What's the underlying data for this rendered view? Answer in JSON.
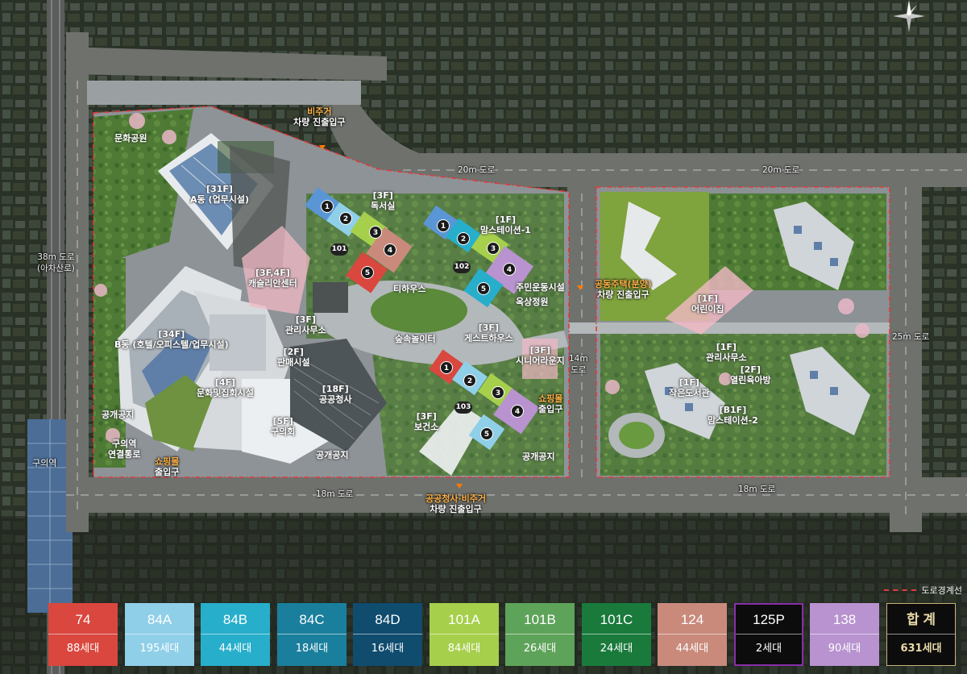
{
  "map": {
    "roads": {
      "top_left": "20m 도로",
      "top_right": "20m 도로",
      "left": "38m 도로\n(아차산로)",
      "right": "25m 도로",
      "middle": "14m\n도로",
      "bottom_left": "18m 도로",
      "bottom_right": "18m 도로"
    },
    "station": "구의역",
    "entrances": {
      "top": {
        "line1": "비주거",
        "line2": "차량 진출입구"
      },
      "right": {
        "line1": "공동주택(분양)",
        "line2": "차량 진출입구"
      },
      "bottom": {
        "line1": "공공청사·비주거",
        "line2": "차량 진출입구"
      },
      "shopping_left": {
        "line1": "쇼핑몰",
        "line2": "출입구"
      },
      "shopping_right": {
        "line1": "쇼핑몰",
        "line2": "출입구"
      }
    },
    "places": {
      "culture_park": "문화공원",
      "building_a": {
        "floor": "[31F]",
        "name": "A동 (업무시설)"
      },
      "building_b": {
        "floor": "[34F]",
        "name": "B동 (호텔/오피스텔/업무시설)"
      },
      "reading_room": {
        "floor": "[3F]",
        "name": "독서실"
      },
      "moms_station_1": {
        "floor": "[1F]",
        "name": "맘스테이션-1"
      },
      "career_center": {
        "floor": "[3F,4F]",
        "name": "캐슬리안센터"
      },
      "management_office_1": {
        "floor": "[3F]",
        "name": "관리사무소"
      },
      "teahouse": "티하우스",
      "resident_gym": "주민운동시설",
      "roof_garden": "옥상정원",
      "forest_playground": "숲속놀이터",
      "guest_house": {
        "floor": "[3F]",
        "name": "게스트하우스"
      },
      "senior_lounge": {
        "floor": "[3F]",
        "name": "시니어라운지"
      },
      "sales_facility": {
        "floor": "[2F]",
        "name": "판매시설"
      },
      "culture_hall": {
        "floor": "[4F]",
        "name": "문화및집회시설"
      },
      "public_office": {
        "floor": "[18F]",
        "name": "공공청사"
      },
      "district_council": {
        "floor": "[5F]",
        "name": "구의회"
      },
      "health_center": {
        "floor": "[3F]",
        "name": "보건소"
      },
      "public_space_1": "공개공지",
      "public_space_2": "공개공지",
      "public_space_3": "공개공지",
      "connecting_passage": {
        "line1": "구의역",
        "line2": "연결통로"
      },
      "kindergarten": {
        "floor": "[1F]",
        "name": "어린이집"
      },
      "management_office_2": {
        "floor": "[1F]",
        "name": "관리사무소"
      },
      "open_nursery": {
        "floor": "[2F]",
        "name": "열린육아방"
      },
      "small_library": {
        "floor": "[1F]",
        "name": "작은도서관"
      },
      "moms_station_2": {
        "floor": "[B1F]",
        "name": "맘스테이션-2"
      }
    },
    "block_numbers": [
      "101",
      "102",
      "103"
    ],
    "unit_numbers": [
      "1",
      "2",
      "3",
      "4",
      "5"
    ],
    "boundary_note": "도로경계선"
  },
  "legend": [
    {
      "type": "74",
      "count": "88세대",
      "color": "#d9473e"
    },
    {
      "type": "84A",
      "count": "195세대",
      "color": "#8fcfe8"
    },
    {
      "type": "84B",
      "count": "44세대",
      "color": "#27aecb"
    },
    {
      "type": "84C",
      "count": "18세대",
      "color": "#1a7f9c"
    },
    {
      "type": "84D",
      "count": "16세대",
      "color": "#0f4c6e"
    },
    {
      "type": "101A",
      "count": "84세대",
      "color": "#a6cf4c"
    },
    {
      "type": "101B",
      "count": "26세대",
      "color": "#5ea35a"
    },
    {
      "type": "101C",
      "count": "24세대",
      "color": "#197a3c"
    },
    {
      "type": "124",
      "count": "44세대",
      "color": "#c98a7c"
    },
    {
      "type": "125P",
      "count": "2세대",
      "color": "#0c0c0c"
    },
    {
      "type": "138",
      "count": "90세대",
      "color": "#b893cf"
    },
    {
      "type": "합 계",
      "count": "631세대",
      "color": "#0c0c0c"
    }
  ],
  "colors": {
    "boundary": "#e23a3a",
    "entry_marker": "#ff7a00",
    "entry_text_accent": "#ffb347"
  }
}
